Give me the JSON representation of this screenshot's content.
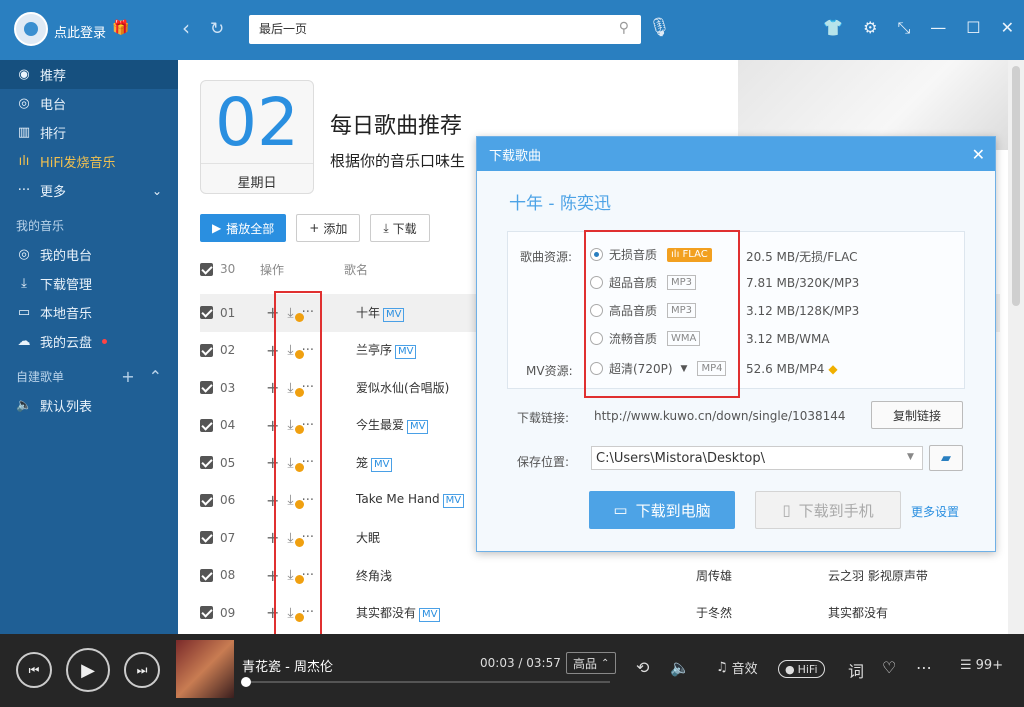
{
  "topbar": {
    "login": "点此登录",
    "search_value": "最后一页",
    "gift_icon": "gift-icon"
  },
  "sidebar": {
    "items": [
      {
        "label": "推荐",
        "icon": "music-note-icon"
      },
      {
        "label": "电台",
        "icon": "radio-icon"
      },
      {
        "label": "排行",
        "icon": "chart-icon"
      },
      {
        "label": "HiFi发烧音乐",
        "icon": "hifi-wave-icon"
      },
      {
        "label": "更多",
        "icon": "dots-icon"
      }
    ],
    "my_music_title": "我的音乐",
    "my_items": [
      {
        "label": "我的电台",
        "icon": "radio-icon"
      },
      {
        "label": "下载管理",
        "icon": "download-icon"
      },
      {
        "label": "本地音乐",
        "icon": "monitor-icon"
      },
      {
        "label": "我的云盘",
        "icon": "cloud-icon"
      }
    ],
    "custom_title": "自建歌单",
    "default_list": "默认列表"
  },
  "main": {
    "date_num": "02",
    "weekday": "星期日",
    "title": "每日歌曲推荐",
    "subtitle": "根据你的音乐口味生",
    "play_all": "播放全部",
    "add": "添加",
    "download": "下载",
    "count": "30",
    "col_ops": "操作",
    "col_name": "歌名",
    "mv_label": "MV",
    "songs": [
      {
        "num": "01",
        "name": "十年",
        "mv": true,
        "artist": "",
        "album": ""
      },
      {
        "num": "02",
        "name": "兰亭序",
        "mv": true,
        "artist": "",
        "album": ""
      },
      {
        "num": "03",
        "name": "爱似水仙(合唱版)",
        "mv": false,
        "artist": "",
        "album": ""
      },
      {
        "num": "04",
        "name": "今生最爱",
        "mv": true,
        "artist": "",
        "album": ""
      },
      {
        "num": "05",
        "name": "笼",
        "mv": true,
        "artist": "",
        "album": ""
      },
      {
        "num": "06",
        "name": "Take Me Hand",
        "mv": true,
        "artist": "",
        "album": ""
      },
      {
        "num": "07",
        "name": "大眠",
        "mv": false,
        "artist": "",
        "album": ""
      },
      {
        "num": "08",
        "name": "终角浅",
        "mv": false,
        "artist": "周传雄",
        "album": "云之羽 影视原声带"
      },
      {
        "num": "09",
        "name": "其实都没有",
        "mv": true,
        "artist": "于冬然",
        "album": "其实都没有"
      }
    ]
  },
  "dialog": {
    "title": "下载歌曲",
    "song": "十年 - 陈奕迅",
    "song_source_label": "歌曲资源:",
    "mv_source_label": "MV资源:",
    "options": [
      {
        "label": "无损音质",
        "format": "FLAC",
        "size": "20.5 MB/无损/FLAC",
        "selected": true
      },
      {
        "label": "超品音质",
        "format": "MP3",
        "size": "7.81 MB/320K/MP3",
        "selected": false
      },
      {
        "label": "高品音质",
        "format": "MP3",
        "size": "3.12 MB/128K/MP3",
        "selected": false
      },
      {
        "label": "流畅音质",
        "format": "WMA",
        "size": "3.12 MB/WMA",
        "selected": false
      }
    ],
    "mv_option": {
      "label": "超清(720P)",
      "format": "MP4",
      "size": "52.6 MB/MP4"
    },
    "link_label": "下载链接:",
    "link_url": "http://www.kuwo.cn/down/single/1038144",
    "copy_btn": "复制链接",
    "save_label": "保存位置:",
    "save_path": "C:\\Users\\Mistora\\Desktop\\",
    "dl_pc": "下载到电脑",
    "dl_phone": "下载到手机",
    "more_settings": "更多设置"
  },
  "player": {
    "title": "青花瓷 - 周杰伦",
    "time": "00:03 / 03:57",
    "quality": "高品",
    "effect": "音效",
    "hifi": "HiFi",
    "count": "99+",
    "progress": 0.012
  }
}
